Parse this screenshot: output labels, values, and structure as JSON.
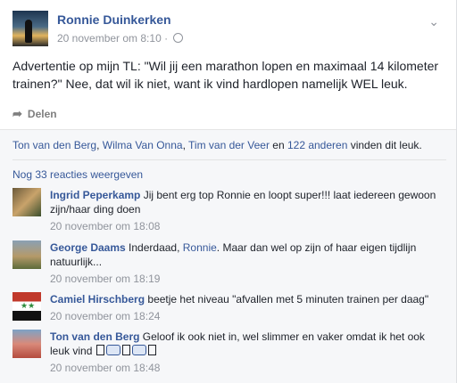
{
  "post": {
    "author": "Ronnie Duinkerken",
    "timestamp": "20 november om 8:10",
    "separator": "·",
    "text": "Advertentie op mijn TL: \"Wil jij een marathon lopen en maximaal 14 kilometer trainen?\" Nee, dat wil ik niet, want ik vind hardlopen namelijk WEL leuk.",
    "share_label": "Delen"
  },
  "likes": {
    "names": [
      "Ton van den Berg",
      "Wilma Van Onna",
      "Tim van der Veer"
    ],
    "sep1": ", ",
    "sep2": ", ",
    "en": " en ",
    "others": "122 anderen",
    "suffix": " vinden dit leuk."
  },
  "more_comments": "Nog 33 reacties weergeven",
  "comments": [
    {
      "name": "Ingrid Peperkamp",
      "text": "Jij bent erg top Ronnie en loopt super!!! laat iedereen gewoon zijn/haar ding doen",
      "time": "20 november om 18:08"
    },
    {
      "name": "George Daams",
      "text_before": "Inderdaad, ",
      "link": "Ronnie",
      "text_after": ". Maar dan wel op zijn of haar eigen tijdlijn natuurlijk...",
      "time": "20 november om 18:19"
    },
    {
      "name": "Camiel Hirschberg",
      "text": "beetje het niveau \"afvallen met 5 minuten trainen per daag\"",
      "time": "20 november om 18:24"
    },
    {
      "name": "Ton van den Berg",
      "text": "Geloof ik ook niet in, wel slimmer en vaker omdat ik het ook leuk vind",
      "time": "20 november om 18:48"
    }
  ],
  "colors": {
    "link": "#365899",
    "meta": "#90949c"
  }
}
